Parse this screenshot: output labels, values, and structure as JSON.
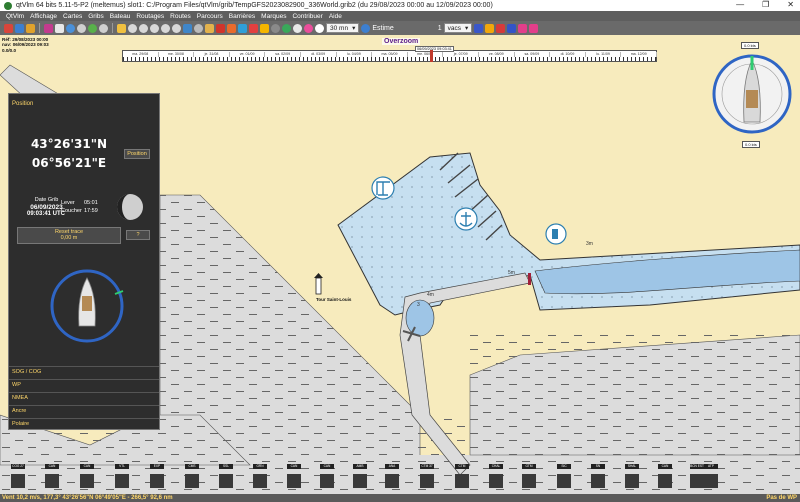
{
  "window": {
    "title": "qtVlm 64 bits 5.11-5-P2 (meltemus) slot1: C:/Program Files/qtVlm/grib/TempGFS2023082900_336World.grib2 (du 29/08/2023 00:00 au 12/09/2023 00:00)",
    "controls": [
      "—",
      "❐",
      "✕"
    ]
  },
  "menu": [
    "QtVlm",
    "Affichage",
    "Cartes",
    "Gribs",
    "Bateau",
    "Routages",
    "Routes",
    "Parcours",
    "Barrières",
    "Marques",
    "Contribuer",
    "Aide"
  ],
  "toolbar": {
    "step_value": "30 mn",
    "mode_label": "Estime",
    "count_value": "1",
    "unit_value": "vacs"
  },
  "grib_info": [
    "Réf: 29/08/2023 00:00",
    "nav: 06/09/2023 09:03",
    "0.0/0.0"
  ],
  "timeline": {
    "cells": [
      "ma. 29/08",
      "me. 30/08",
      "je. 31/08",
      "ve. 01/09",
      "sa. 02/09",
      "di. 03/09",
      "lu. 04/09",
      "ma. 05/09",
      "me. 06/09",
      "je. 07/09",
      "ve. 08/09",
      "sa. 09/09",
      "di. 10/09",
      "lu. 11/09",
      "ma. 12/09"
    ],
    "overzoom_label": "Overzoom",
    "cursor_label": "06/09/2023 09:03:41"
  },
  "panel": {
    "position_header": "Position",
    "latitude": "43°26'31\"N",
    "longitude": "06°56'21\"E",
    "position_button": "Position",
    "date_grib_label": "Date Grib",
    "date_value": "06/09/2023",
    "time_value": "09:03:41 UTC",
    "lever_label": "Lever",
    "lever_value": "05:01",
    "coucher_label": "Coucher",
    "coucher_value": "17:59",
    "reset_trace_label": "Reset trace",
    "reset_trace_value": "0,00 m",
    "help_button": "?",
    "sections": [
      "SOG / COG",
      "WP",
      "NMEA",
      "Ancre",
      "Polaire"
    ]
  },
  "map": {
    "lighthouse_label": "Tour Saint-Louis",
    "depths": [
      "3m",
      "5m",
      "4m",
      "3"
    ],
    "colors": {
      "land": "#f7ebbd",
      "water": "#c6dff0",
      "water_dark": "#9ec5e6",
      "shoal": "#dcdcdc"
    }
  },
  "compass": {
    "top_label": "0.0 kts",
    "bottom_label": "0.0 kts"
  },
  "waypoints": [
    "COG 27",
    "CAN",
    "CAN",
    "VTL",
    "EXP",
    "CMS",
    "SSL",
    "GRN",
    "CAN",
    "CAN",
    "AMB",
    "ANA",
    "CTM 37",
    "CTM",
    "CHAL",
    "GTM",
    "SIC",
    "SN",
    "SHAL",
    "CAN",
    "BCN EST",
    "ATP"
  ],
  "status": {
    "left": "Vent 10,2 m/s, 177,3° 43°26'56\"N 06°49'05\"E - 266,5° 92,6 nm",
    "right": "Pas de WP"
  }
}
